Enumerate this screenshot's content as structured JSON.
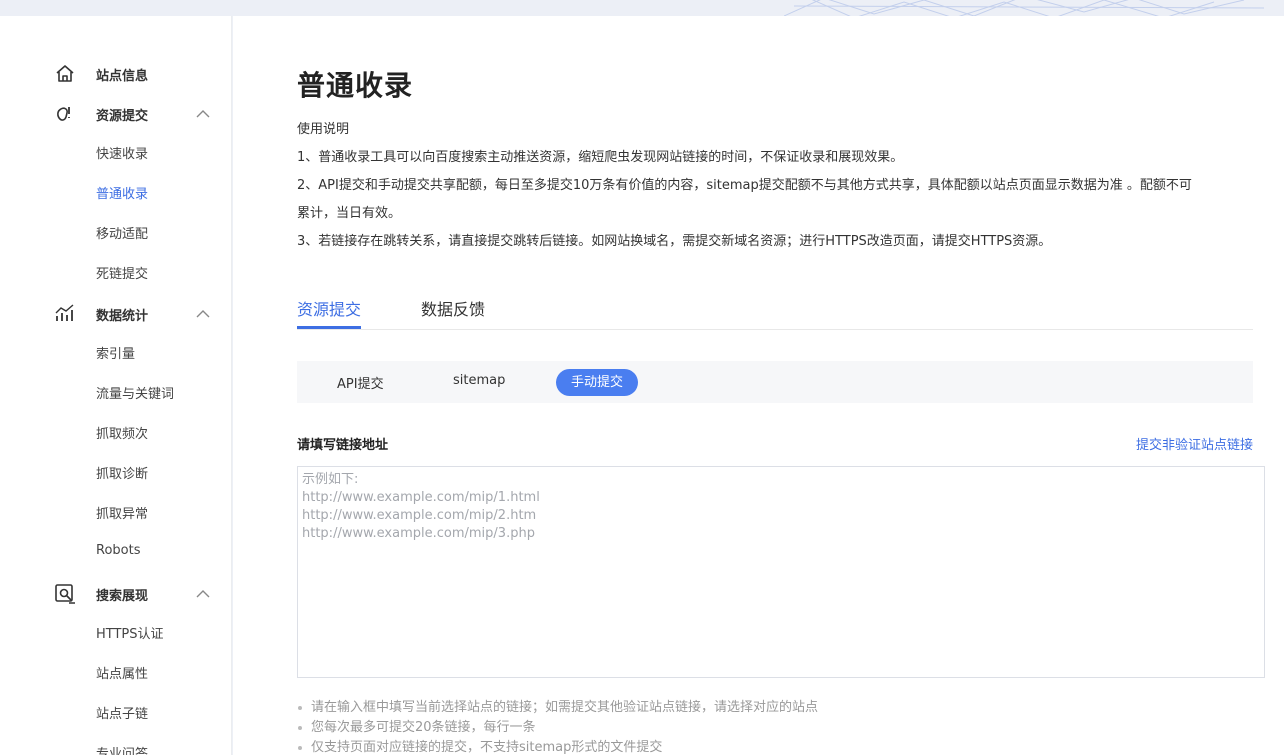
{
  "sidebar": {
    "groups": [
      {
        "label": "站点信息",
        "icon": "home-icon",
        "chevron": false
      },
      {
        "label": "资源提交",
        "icon": "submit-icon",
        "chevron": true
      },
      {
        "label": "数据统计",
        "icon": "chart-icon",
        "chevron": true
      },
      {
        "label": "搜索展现",
        "icon": "search-display-icon",
        "chevron": true
      }
    ],
    "submit_items": [
      "快速收录",
      "普通收录",
      "移动适配",
      "死链提交"
    ],
    "stats_items": [
      "索引量",
      "流量与关键词",
      "抓取频次",
      "抓取诊断",
      "抓取异常",
      "Robots"
    ],
    "display_items": [
      "HTTPS认证",
      "站点属性",
      "站点子链",
      "专业问答"
    ],
    "active_item": "普通收录"
  },
  "main": {
    "title": "普通收录",
    "usage_heading": "使用说明",
    "usage_lines": [
      "1、普通收录工具可以向百度搜索主动推送资源，缩短爬虫发现网站链接的时间，不保证收录和展现效果。",
      "2、API提交和手动提交共享配额，每日至多提交10万条有价值的内容，sitemap提交配额不与其他方式共享，具体配额以站点页面显示数据为准 。配额不可",
      "累计，当日有效。",
      "3、若链接存在跳转关系，请直接提交跳转后链接。如网站换域名，需提交新域名资源；进行HTTPS改造页面，请提交HTTPS资源。"
    ],
    "tabs": [
      "资源提交",
      "数据反馈"
    ],
    "active_tab": "资源提交",
    "subtabs": [
      "API提交",
      "sitemap",
      "手动提交"
    ],
    "active_subtab": "手动提交",
    "field_label": "请填写链接地址",
    "field_link": "提交非验证站点链接",
    "placeholder_lines": [
      "示例如下:",
      "http://www.example.com/mip/1.html",
      "http://www.example.com/mip/2.htm",
      "http://www.example.com/mip/3.php"
    ],
    "notes": [
      "请在输入框中填写当前选择站点的链接；如需提交其他验证站点链接，请选择对应的站点",
      "您每次最多可提交20条链接，每行一条",
      "仅支持页面对应链接的提交，不支持sitemap形式的文件提交"
    ]
  },
  "colors": {
    "accent": "#3d6ee3",
    "pill": "#4a7ef0"
  }
}
